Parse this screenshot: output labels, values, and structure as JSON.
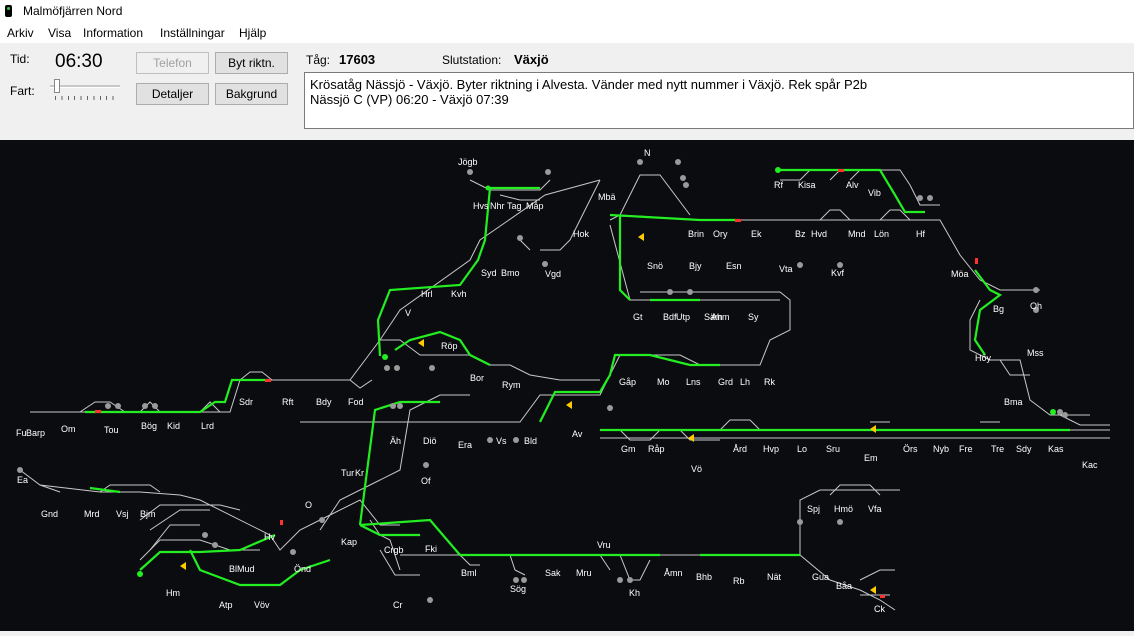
{
  "window": {
    "title": "Malmöfjärren Nord"
  },
  "menu": [
    "Arkiv",
    "Visa",
    "Information",
    "Inställningar",
    "Hjälp"
  ],
  "controls": {
    "time_label": "Tid:",
    "time_value": "06:30",
    "speed_label": "Fart:",
    "telefon": "Telefon",
    "byt_riktning": "Byt riktn.",
    "detaljer": "Detaljer",
    "bakgrund": "Bakgrund",
    "train_label": "Tåg:",
    "train_number": "17603",
    "destination_label": "Slutstation:",
    "destination": "Växjö"
  },
  "info": {
    "line1": "Krösatåg Nässjö - Växjö. Byter riktning i Alvesta. Vänder med nytt nummer i Växjö. Rek spår P2b",
    "line2": "Nässjö C (VP) 06:20 - Växjö 07:39"
  },
  "colors": {
    "track": "#c8c8c8",
    "route": "#22ee22",
    "signal_red": "#ff3030",
    "signal_yellow": "#ffcc00",
    "station_dot": "#9a9a9a"
  },
  "stations": [
    "Jögb",
    "Hvs",
    "Nhr",
    "Tag",
    "Måp",
    "Mbä",
    "N",
    "Hok",
    "Rf",
    "Kisa",
    "Alv",
    "Vib",
    "Brin",
    "Ory",
    "Ek",
    "Bz",
    "Hvd",
    "Mnd",
    "Lön",
    "Hf",
    "Snö",
    "Bjy",
    "Esn",
    "Vta",
    "Kvf",
    "Syd",
    "Bmo",
    "Vgd",
    "Hrl",
    "Kvh",
    "Möa",
    "Oh",
    "Bg",
    "Mss",
    "Höy",
    "V",
    "Röp",
    "Gt",
    "Bdf",
    "Utp",
    "Säm",
    "Ahm",
    "Sy",
    "Bor",
    "Rym",
    "Gåp",
    "Mo",
    "Lns",
    "Grd",
    "Lh",
    "Rk",
    "Bma",
    "Sdr",
    "Rft",
    "Bdy",
    "Fod",
    "Fu",
    "Barp",
    "Om",
    "Tou",
    "Bög",
    "Kid",
    "Lrd",
    "Äh",
    "Diö",
    "Era",
    "Vs",
    "Bld",
    "Av",
    "Gm",
    "Råp",
    "Vö",
    "Ård",
    "Hvp",
    "Lo",
    "Sru",
    "Em",
    "Örs",
    "Nyb",
    "Fre",
    "Tre",
    "Sdy",
    "Kas",
    "Kac",
    "Ea",
    "Tur",
    "Kr",
    "Of",
    "Gnd",
    "Mrd",
    "Vsj",
    "Bjm",
    "O",
    "Spj",
    "Hmö",
    "Vfa",
    "Kap",
    "Crgb",
    "Fki",
    "Vru",
    "Hv",
    "BlMud",
    "Önd",
    "Hm",
    "Atp",
    "Vöv",
    "Bml",
    "Sög",
    "Sak",
    "Mru",
    "Kh",
    "Åmn",
    "Bhb",
    "Rb",
    "Nät",
    "Gua",
    "Båa",
    "Ck",
    "Cr"
  ]
}
